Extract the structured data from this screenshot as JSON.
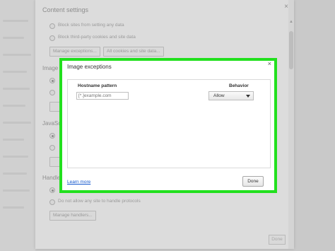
{
  "background": {
    "title": "Content settings",
    "close": "×",
    "rows": [
      "Block sites from setting any data",
      "Block third-party cookies and site data"
    ],
    "buttons": {
      "manage_exceptions": "Manage exceptions...",
      "all_cookies": "All cookies and site data...",
      "manage_handlers": "Manage handlers..."
    },
    "sections": {
      "images": "Image",
      "javascript": "JavaSc",
      "handlers": "Handle"
    },
    "handlers_option": "Do not allow any site to handle protocols",
    "done": "Done"
  },
  "dialog": {
    "title": "Image exceptions",
    "close": "×",
    "columns": {
      "hostname": "Hostname pattern",
      "behavior": "Behavior"
    },
    "hostname_placeholder": "[*.]example.com",
    "behavior_value": "Allow",
    "learn_more": "Learn more",
    "done": "Done"
  },
  "colors": {
    "highlight": "#22e01e",
    "link": "#1155cc"
  }
}
